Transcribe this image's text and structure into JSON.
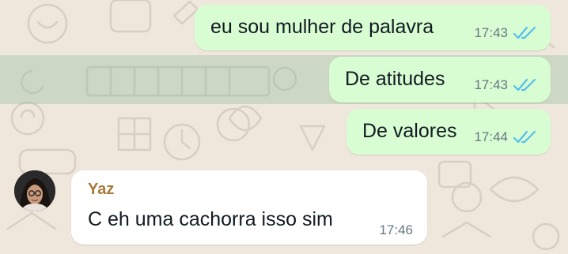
{
  "messages_out": [
    {
      "text": "eu sou mulher de palavra",
      "time": "17:43",
      "status": "read-double-check-icon"
    },
    {
      "text": "De atitudes",
      "time": "17:43",
      "status": "read-double-check-icon"
    },
    {
      "text": "De valores",
      "time": "17:44",
      "status": "read-double-check-icon"
    }
  ],
  "message_in": {
    "sender": "Yaz",
    "text": "C eh uma cachorra isso sim",
    "time": "17:46"
  },
  "colors": {
    "outgoing_bubble": "#d9fdd3",
    "incoming_bubble": "#ffffff",
    "read_tick": "#53bdeb",
    "sender_name": "#a5793a",
    "time_text": "#667781"
  }
}
